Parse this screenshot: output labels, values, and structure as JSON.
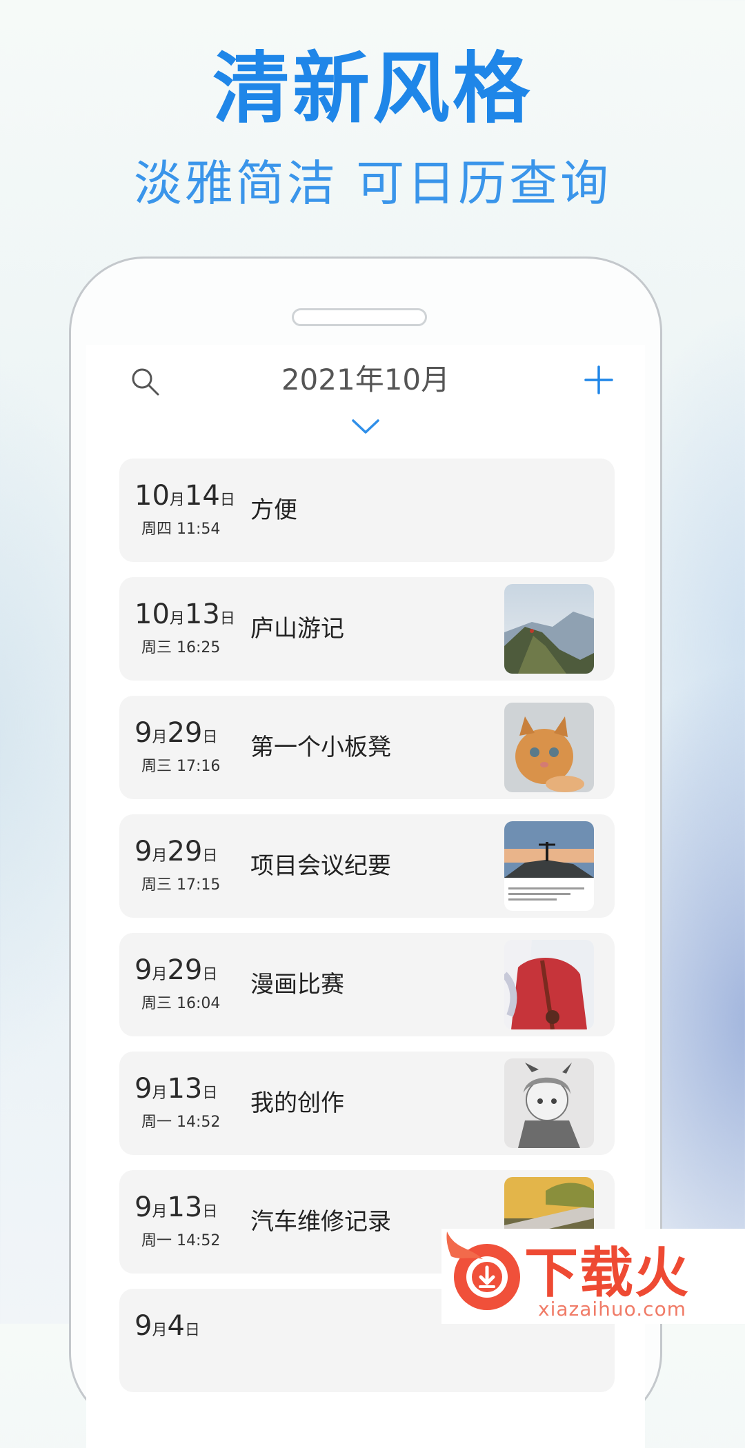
{
  "promo": {
    "headline": "清新风格",
    "subline": "淡雅简洁 可日历查询"
  },
  "header": {
    "month_title": "2021年10月",
    "search_icon": "search-icon",
    "add_icon": "plus-icon",
    "expand_icon": "chevron-down-icon"
  },
  "entries": [
    {
      "month": "10",
      "month_unit": "月",
      "day": "14",
      "day_unit": "日",
      "sub": "周四 11:54",
      "title": "方便",
      "thumb": ""
    },
    {
      "month": "10",
      "month_unit": "月",
      "day": "13",
      "day_unit": "日",
      "sub": "周三 16:25",
      "title": "庐山游记",
      "thumb": "mountain"
    },
    {
      "month": "9",
      "month_unit": "月",
      "day": "29",
      "day_unit": "日",
      "sub": "周三 17:16",
      "title": "第一个小板凳",
      "thumb": "kitten"
    },
    {
      "month": "9",
      "month_unit": "月",
      "day": "29",
      "day_unit": "日",
      "sub": "周三 17:15",
      "title": "项目会议纪要",
      "thumb": "summit"
    },
    {
      "month": "9",
      "month_unit": "月",
      "day": "29",
      "day_unit": "日",
      "sub": "周三 16:04",
      "title": "漫画比赛",
      "thumb": "anime"
    },
    {
      "month": "9",
      "month_unit": "月",
      "day": "13",
      "day_unit": "日",
      "sub": "周一 14:52",
      "title": "我的创作",
      "thumb": "sketch"
    },
    {
      "month": "9",
      "month_unit": "月",
      "day": "13",
      "day_unit": "日",
      "sub": "周一 14:52",
      "title": "汽车维修记录",
      "thumb": "road"
    },
    {
      "month": "9",
      "month_unit": "月",
      "day": "4",
      "day_unit": "日",
      "sub": "",
      "title": "",
      "thumb": ""
    }
  ],
  "watermark": {
    "logo_text": "下载火",
    "url": "xiazaihuo.com"
  },
  "colors": {
    "accent": "#1f86e8",
    "card_bg": "#f4f4f4",
    "watermark": "#ee4a33"
  }
}
